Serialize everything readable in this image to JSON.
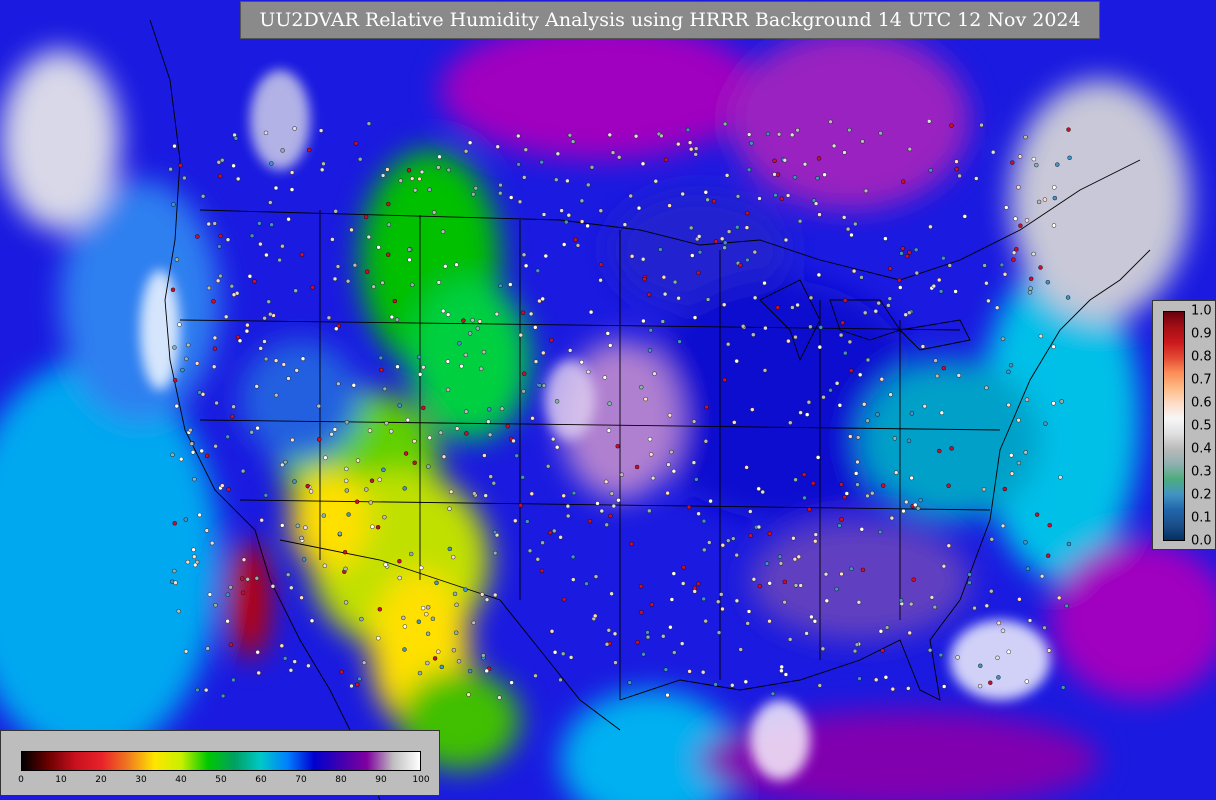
{
  "map": {
    "title": "UU2DVAR Relative Humidity Analysis using HRRR Background 14 UTC 12 Nov 2024"
  },
  "rh_colorbar": {
    "ticks": [
      "0",
      "10",
      "20",
      "30",
      "40",
      "50",
      "60",
      "70",
      "80",
      "90",
      "100"
    ],
    "colors": [
      "#000000",
      "#6b0000",
      "#c8101e",
      "#e8222a",
      "#f07a20",
      "#ffe600",
      "#c8f000",
      "#00c800",
      "#00a060",
      "#00c8c8",
      "#0080ff",
      "#0000d0",
      "#4000b0",
      "#8000a0",
      "#c0c0c0",
      "#ffffff"
    ]
  },
  "obs_colorbar": {
    "ticks": [
      "1.0",
      "0.9",
      "0.8",
      "0.7",
      "0.6",
      "0.5",
      "0.4",
      "0.3",
      "0.2",
      "0.1",
      "0.0"
    ],
    "colors": [
      "#67000d",
      "#a50f15",
      "#cb181d",
      "#e34a33",
      "#fc8d59",
      "#fdbb84",
      "#fddbc7",
      "#f7f7f7",
      "#e0e0e0",
      "#bababa",
      "#8fb0b0",
      "#4dac7e",
      "#4393c3",
      "#2166ac",
      "#1a4f8a",
      "#053061"
    ]
  }
}
